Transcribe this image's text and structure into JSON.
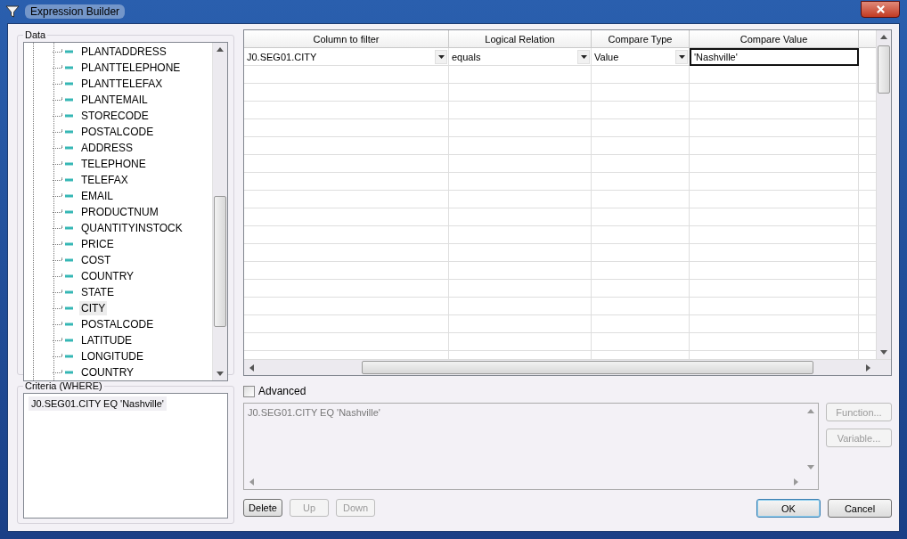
{
  "window": {
    "title": "Expression Builder"
  },
  "data_panel": {
    "label": "Data",
    "items": [
      {
        "label": "PLANTADDRESS",
        "selected": false
      },
      {
        "label": "PLANTTELEPHONE",
        "selected": false
      },
      {
        "label": "PLANTTELEFAX",
        "selected": false
      },
      {
        "label": "PLANTEMAIL",
        "selected": false
      },
      {
        "label": "STORECODE",
        "selected": false
      },
      {
        "label": "POSTALCODE",
        "selected": false
      },
      {
        "label": "ADDRESS",
        "selected": false
      },
      {
        "label": "TELEPHONE",
        "selected": false
      },
      {
        "label": "TELEFAX",
        "selected": false
      },
      {
        "label": "EMAIL",
        "selected": false
      },
      {
        "label": "PRODUCTNUM",
        "selected": false
      },
      {
        "label": "QUANTITYINSTOCK",
        "selected": false
      },
      {
        "label": "PRICE",
        "selected": false
      },
      {
        "label": "COST",
        "selected": false
      },
      {
        "label": "COUNTRY",
        "selected": false
      },
      {
        "label": "STATE",
        "selected": false
      },
      {
        "label": "CITY",
        "selected": true
      },
      {
        "label": "POSTALCODE",
        "selected": false
      },
      {
        "label": "LATITUDE",
        "selected": false
      },
      {
        "label": "LONGITUDE",
        "selected": false
      },
      {
        "label": "COUNTRY",
        "selected": false
      }
    ]
  },
  "grid": {
    "columns": [
      "Column to filter",
      "Logical Relation",
      "Compare Type",
      "Compare Value"
    ],
    "rows": [
      {
        "column": "J0.SEG01.CITY",
        "relation": "equals",
        "compare_type": "Value",
        "compare_value": "'Nashville'"
      }
    ]
  },
  "criteria": {
    "label": "Criteria (WHERE)",
    "items": [
      {
        "text": "J0.SEG01.CITY EQ 'Nashville'",
        "selected": true
      }
    ]
  },
  "advanced": {
    "label": "Advanced",
    "checked": false
  },
  "expression": {
    "value": "J0.SEG01.CITY EQ 'Nashville'",
    "disabled": true
  },
  "side_buttons": [
    {
      "label": "Function...",
      "disabled": true
    },
    {
      "label": "Variable...",
      "disabled": true
    }
  ],
  "left_buttons": [
    {
      "label": "Delete",
      "disabled": false
    },
    {
      "label": "Up",
      "disabled": true
    },
    {
      "label": "Down",
      "disabled": true
    }
  ],
  "right_buttons": [
    {
      "label": "OK",
      "disabled": false,
      "default": true
    },
    {
      "label": "Cancel",
      "disabled": false,
      "default": false
    }
  ]
}
